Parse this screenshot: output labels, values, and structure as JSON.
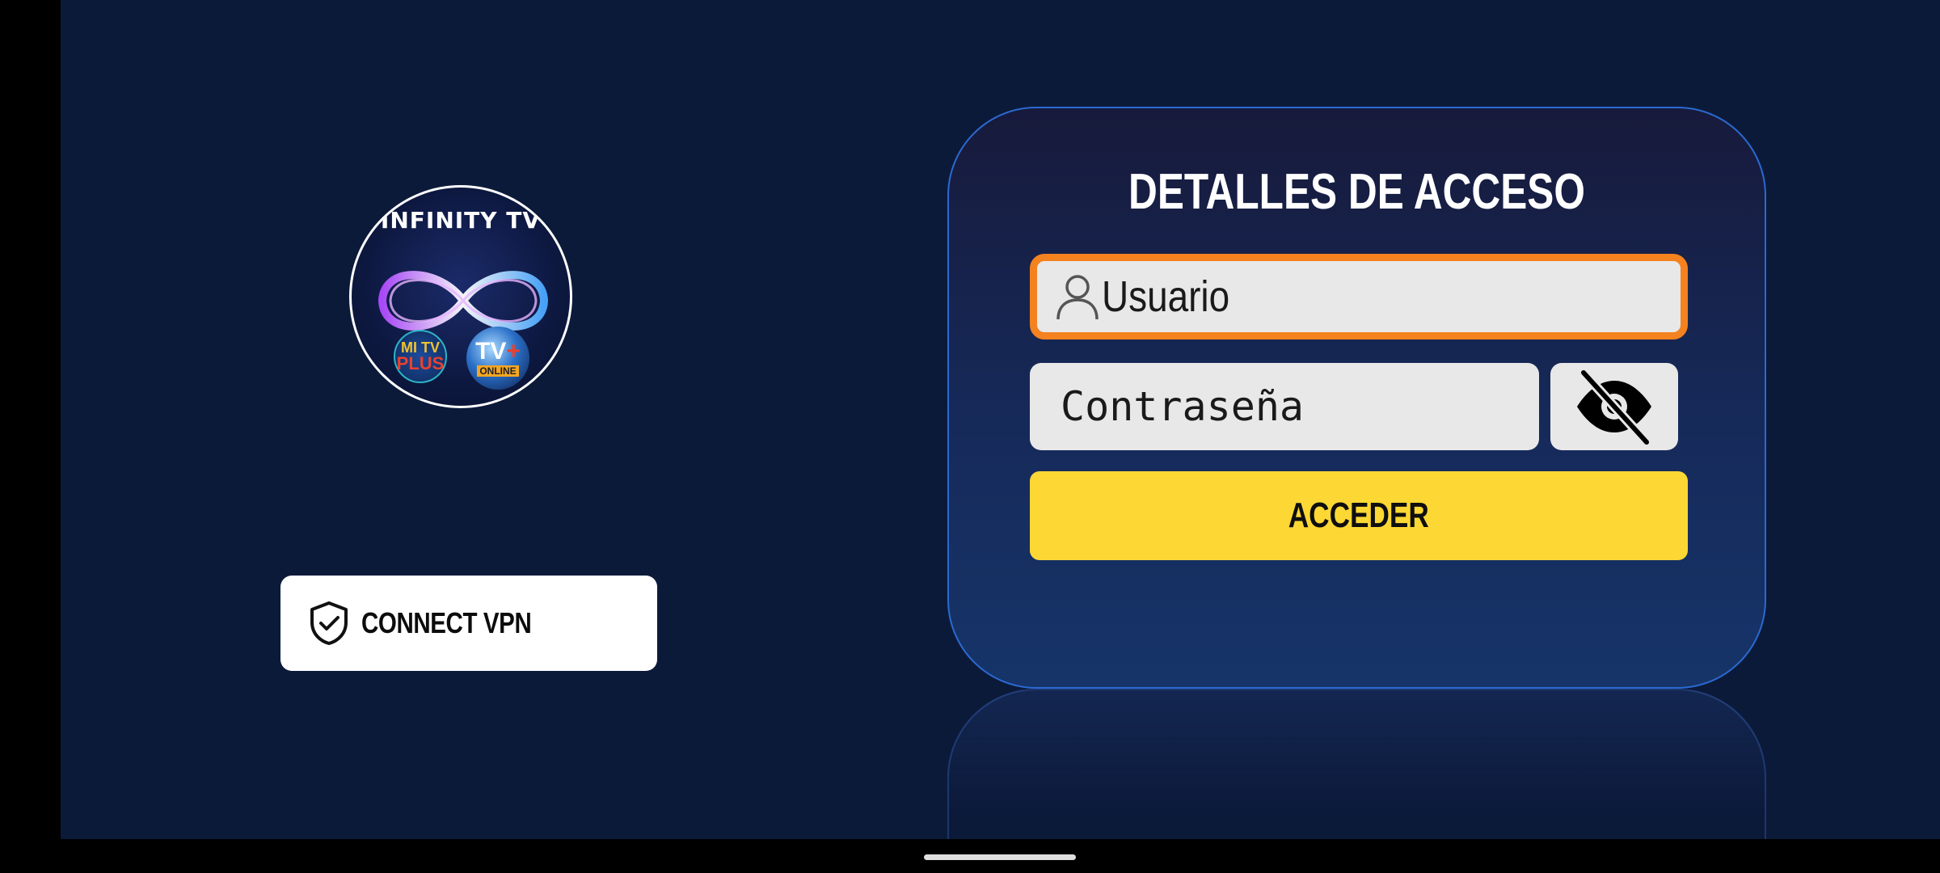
{
  "logo": {
    "title": "INFINITY TV",
    "badge_left_line1": "MI TV",
    "badge_left_line2": "PLUS",
    "badge_right_line1": "TV",
    "badge_right_plus": "+",
    "badge_right_line2": "ONLINE"
  },
  "vpn": {
    "label": "CONNECT VPN",
    "icon": "shield-check-icon"
  },
  "login": {
    "title": "DETALLES DE ACCESO",
    "username_placeholder": "Usuario",
    "username_value": "",
    "password_placeholder": "Contraseña",
    "password_value": "",
    "toggle_icon": "eye-off-icon",
    "submit_label": "ACCEDER"
  },
  "colors": {
    "background": "#0c1a3a",
    "accent_focus": "#f3821f",
    "submit": "#fdd835",
    "card_border": "#2a6ad1"
  }
}
